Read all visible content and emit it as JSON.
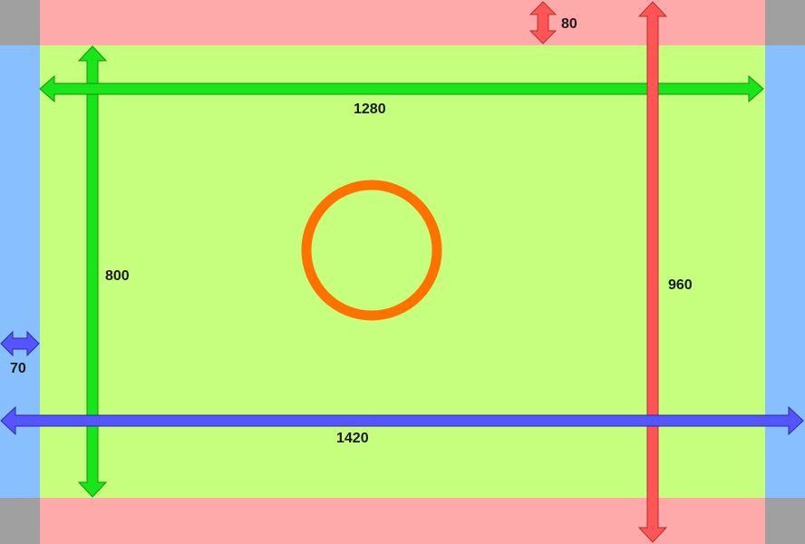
{
  "colors": {
    "corner": "#a0a0a0",
    "top_bottom_band": "#ffaaaa",
    "side_band": "#88c0ff",
    "center_area": "#c6ff7e",
    "green_arrow": "#19e619",
    "red_arrow": "#ff5555",
    "blue_arrow": "#5555ff",
    "circle": "#ff7200"
  },
  "labels": {
    "safe_width": "1280",
    "safe_height": "800",
    "full_width": "1420",
    "full_height": "960",
    "side_margin": "70",
    "top_margin": "80"
  },
  "icons": {
    "circle": "center-circle"
  }
}
